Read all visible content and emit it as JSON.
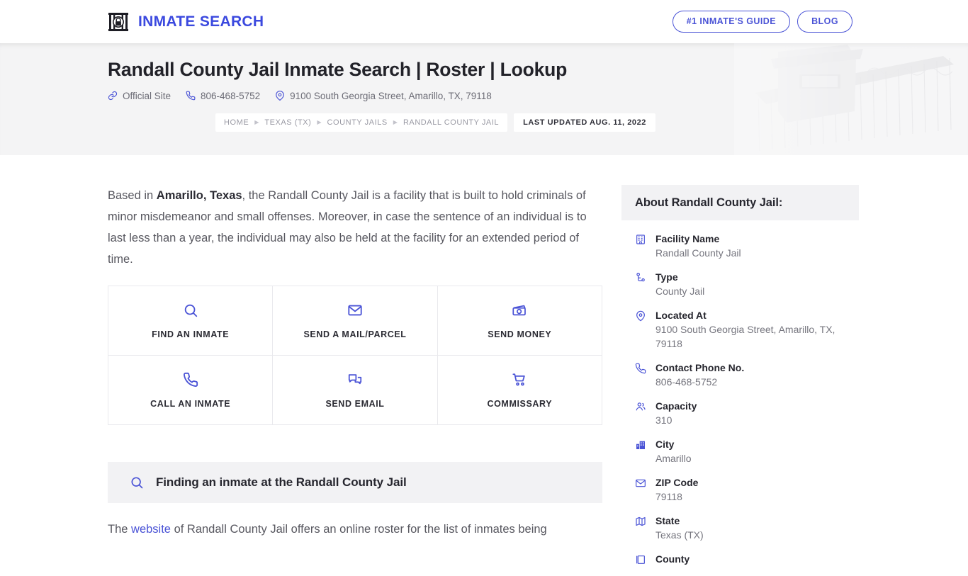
{
  "nav": {
    "brand": "INMATE SEARCH",
    "brand_icon": "jail-lock-logo-icon",
    "buttons": [
      {
        "label": "#1 INMATE'S GUIDE",
        "name": "inmates-guide-button"
      },
      {
        "label": "BLOG",
        "name": "blog-button"
      }
    ]
  },
  "hero": {
    "title": "Randall County Jail Inmate Search | Roster | Lookup",
    "meta": [
      {
        "icon": "link-icon",
        "label": "Official Site",
        "name": "official-site-link"
      },
      {
        "icon": "phone-icon",
        "label": "806-468-5752",
        "name": "hero-phone-link"
      },
      {
        "icon": "location-pin-icon",
        "label": "9100 South Georgia Street, Amarillo, TX, 79118",
        "name": "hero-address"
      }
    ],
    "background_art": "prison-watchtower-fence-image"
  },
  "breadcrumb": {
    "items": [
      "HOME",
      "TEXAS (TX)",
      "COUNTY JAILS",
      "RANDALL COUNTY JAIL"
    ],
    "last_updated": "LAST UPDATED AUG. 11, 2022"
  },
  "main": {
    "lede": {
      "pre": "Based in ",
      "bold": "Amarillo, Texas",
      "post": ", the Randall County Jail is a facility that is built to hold criminals of minor misdemeanor and small offenses. Moreover, in case the sentence of an individual is to last less than a year, the individual may also be held at the facility for an extended period of time."
    },
    "actions": [
      {
        "label": "FIND AN INMATE",
        "icon": "search-icon",
        "name": "action-find-an-inmate"
      },
      {
        "label": "SEND A MAIL/PARCEL",
        "icon": "envelope-icon",
        "name": "action-send-a-mail-parcel"
      },
      {
        "label": "SEND MONEY",
        "icon": "banknote-icon",
        "name": "action-send-money"
      },
      {
        "label": "CALL AN INMATE",
        "icon": "phone-icon",
        "name": "action-call-an-inmate"
      },
      {
        "label": "SEND EMAIL",
        "icon": "chat-bubbles-icon",
        "name": "action-send-email"
      },
      {
        "label": "COMMISSARY",
        "icon": "shopping-cart-icon",
        "name": "action-commissary"
      }
    ],
    "section": {
      "icon": "search-icon",
      "heading": "Finding an inmate at the Randall County Jail"
    },
    "paragraph": {
      "pre": "The ",
      "link": "website",
      "post": " of Randall County Jail offers an online roster for the list of inmates being"
    }
  },
  "sidebar": {
    "title": "About Randall County Jail:",
    "fields": [
      {
        "icon": "building-grid-icon",
        "key": "Facility Name",
        "value": "Randall County Jail",
        "name": "field-facility-name"
      },
      {
        "icon": "node-branch-icon",
        "key": "Type",
        "value": "County Jail",
        "name": "field-type"
      },
      {
        "icon": "location-pin-icon",
        "key": "Located At",
        "value": "9100 South Georgia Street, Amarillo, TX, 79118",
        "name": "field-located-at"
      },
      {
        "icon": "phone-icon",
        "key": "Contact Phone No.",
        "value": "806-468-5752",
        "name": "field-contact-phone"
      },
      {
        "icon": "users-icon",
        "key": "Capacity",
        "value": "310",
        "name": "field-capacity"
      },
      {
        "icon": "city-buildings-icon",
        "key": "City",
        "value": "Amarillo",
        "name": "field-city"
      },
      {
        "icon": "envelope-icon",
        "key": "ZIP Code",
        "value": "79118",
        "name": "field-zip-code"
      },
      {
        "icon": "map-icon",
        "key": "State",
        "value": "Texas (TX)",
        "name": "field-state"
      },
      {
        "icon": "book-icon",
        "key": "County",
        "value": "",
        "name": "field-county"
      }
    ]
  },
  "colors": {
    "accent": "#4a53d6",
    "brand": "#3b49df",
    "hero_bg": "#f4f4f5",
    "panel_bg": "#f2f2f4",
    "body_text": "#57575f",
    "muted": "#9a9aa4"
  }
}
